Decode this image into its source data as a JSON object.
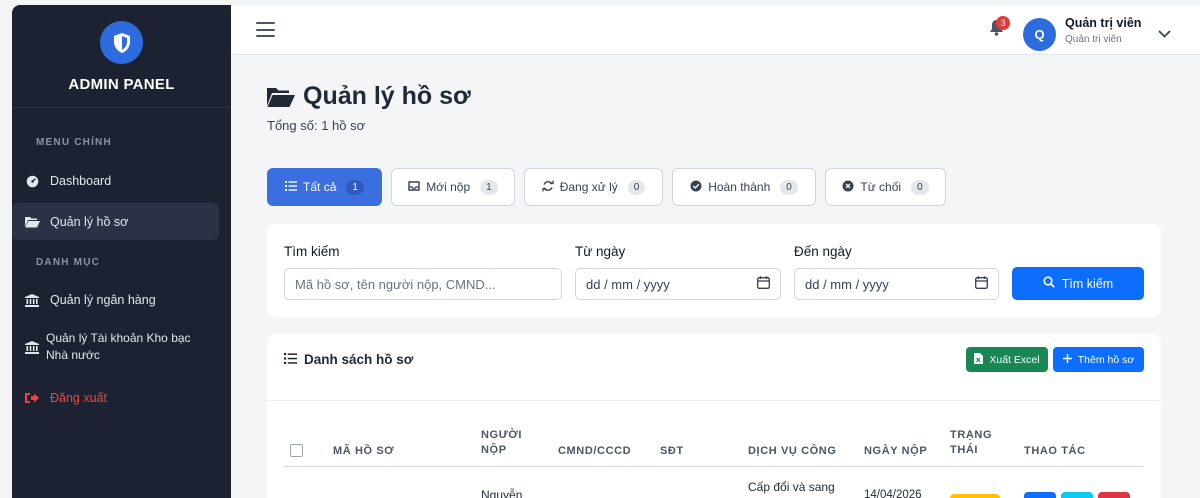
{
  "sidebar": {
    "brand": "ADMIN PANEL",
    "section_main": "MENU CHÍNH",
    "section_category": "DANH MỤC",
    "items": [
      {
        "label": "Dashboard",
        "icon": "tachometer-icon"
      },
      {
        "label": "Quản lý hồ sơ",
        "icon": "folder-open-icon",
        "active": true
      },
      {
        "label": "Quản lý ngân hàng",
        "icon": "bank-icon"
      },
      {
        "label": "Quản lý Tài khoản Kho bạc Nhà nước",
        "line1": "Quản lý Tài khoản Kho bạc",
        "line2": "Nhà nước",
        "icon": "bank-icon"
      },
      {
        "label": "Đăng xuất",
        "icon": "sign-out-icon"
      }
    ]
  },
  "topbar": {
    "notification_count": "3",
    "avatar_initial": "Q",
    "user_name": "Quản trị viên",
    "user_role": "Quản trị viên"
  },
  "page": {
    "title": "Quản lý hồ sơ",
    "subtitle": "Tổng số: 1 hồ sơ"
  },
  "tabs": [
    {
      "label": "Tất cả",
      "count": "1",
      "icon": "list-icon",
      "active": true
    },
    {
      "label": "Mới nộp",
      "count": "1",
      "icon": "inbox-icon"
    },
    {
      "label": "Đang xử lý",
      "count": "0",
      "icon": "sync-icon"
    },
    {
      "label": "Hoàn thành",
      "count": "0",
      "icon": "check-circle-icon"
    },
    {
      "label": "Từ chối",
      "count": "0",
      "icon": "times-circle-icon"
    }
  ],
  "search": {
    "keyword_label": "Tìm kiếm",
    "keyword_placeholder": "Mã hồ sơ, tên người nộp, CMND...",
    "from_label": "Từ ngày",
    "from_value": "dd / mm / yyyy",
    "to_label": "Đến ngày",
    "to_value": "dd / mm / yyyy",
    "button": "Tìm kiếm"
  },
  "list": {
    "title": "Danh sách hồ sơ",
    "export_button": "Xuất Excel",
    "add_button": "Thêm hồ sơ",
    "columns": {
      "code": "MÃ HỒ SƠ",
      "submitter_1": "NGƯỜI",
      "submitter_2": "NỘP",
      "id_card": "CMND/CCCD",
      "phone": "SĐT",
      "service": "DỊCH VỤ CÔNG",
      "date": "NGÀY NỘP",
      "status_1": "TRẠNG",
      "status_2": "THÁI",
      "actions": "THAO TÁC"
    },
    "rows": [
      {
        "submitter": "Nguyễn",
        "service": "Cấp đổi và sang",
        "date": "14/04/2026"
      }
    ]
  },
  "colors": {
    "primary": "#0d6efd",
    "sidebar_bg": "#1c2231",
    "success": "#198754",
    "danger": "#ef4444",
    "warning": "#ffc107"
  }
}
